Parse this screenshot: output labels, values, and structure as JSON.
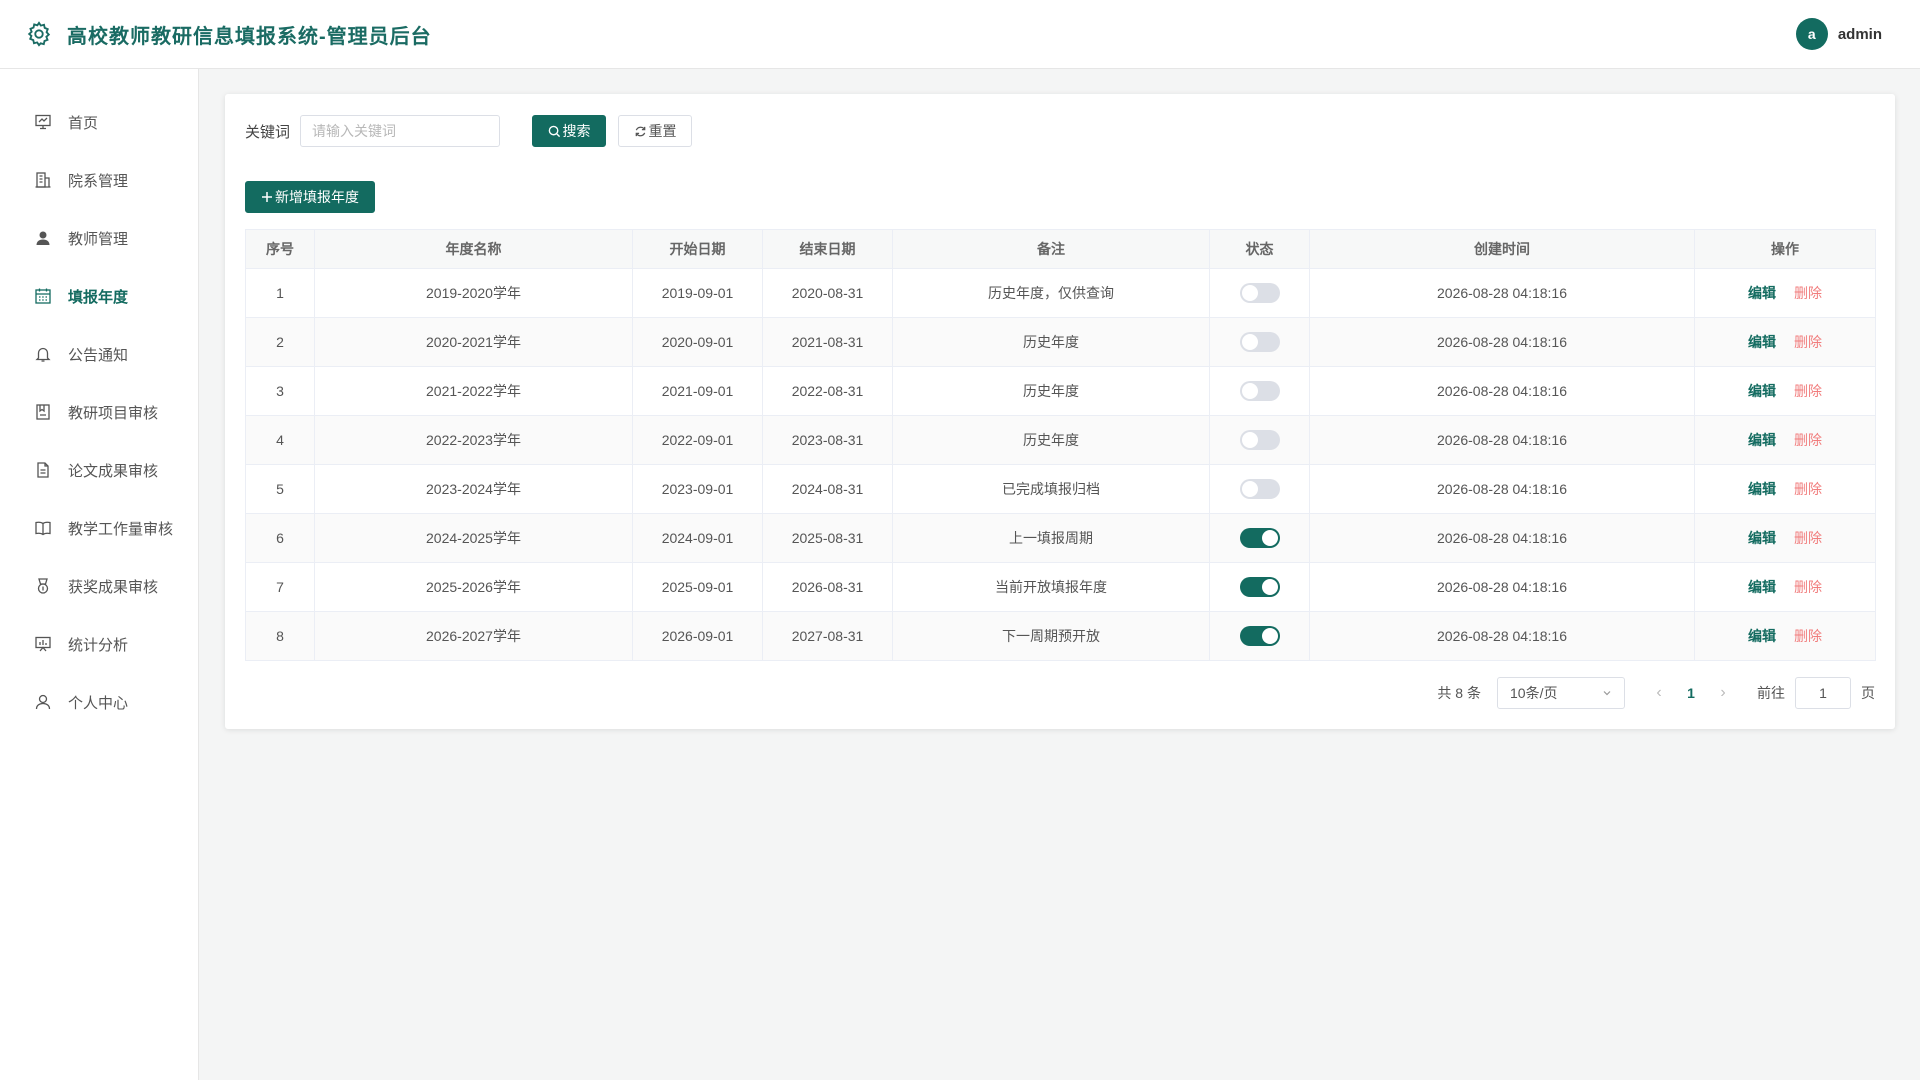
{
  "header": {
    "title": "高校教师教研信息填报系统-管理员后台",
    "avatar_letter": "a",
    "username": "admin"
  },
  "sidebar": {
    "items": [
      {
        "label": "首页",
        "icon": "dashboard-icon"
      },
      {
        "label": "院系管理",
        "icon": "building-icon"
      },
      {
        "label": "教师管理",
        "icon": "user-filled-icon"
      },
      {
        "label": "填报年度",
        "icon": "calendar-icon",
        "active": true
      },
      {
        "label": "公告通知",
        "icon": "bell-icon"
      },
      {
        "label": "教研项目审核",
        "icon": "notebook-icon"
      },
      {
        "label": "论文成果审核",
        "icon": "document-icon"
      },
      {
        "label": "教学工作量审核",
        "icon": "book-icon"
      },
      {
        "label": "获奖成果审核",
        "icon": "medal-icon"
      },
      {
        "label": "统计分析",
        "icon": "chart-board-icon"
      },
      {
        "label": "个人中心",
        "icon": "user-icon"
      }
    ]
  },
  "search": {
    "label": "关键词",
    "placeholder": "请输入关键词",
    "value": "",
    "search_label": "搜索",
    "reset_label": "重置"
  },
  "toolbar": {
    "add_label": "新增填报年度"
  },
  "table": {
    "columns": [
      "序号",
      "年度名称",
      "开始日期",
      "结束日期",
      "备注",
      "状态",
      "创建时间",
      "操作"
    ],
    "edit_label": "编辑",
    "delete_label": "删除",
    "rows": [
      {
        "index": "1",
        "name": "2019-2020学年",
        "start": "2019-09-01",
        "end": "2020-08-31",
        "remark": "历史年度，仅供查询",
        "enabled": false,
        "created": "2026-08-28 04:18:16"
      },
      {
        "index": "2",
        "name": "2020-2021学年",
        "start": "2020-09-01",
        "end": "2021-08-31",
        "remark": "历史年度",
        "enabled": false,
        "created": "2026-08-28 04:18:16"
      },
      {
        "index": "3",
        "name": "2021-2022学年",
        "start": "2021-09-01",
        "end": "2022-08-31",
        "remark": "历史年度",
        "enabled": false,
        "created": "2026-08-28 04:18:16"
      },
      {
        "index": "4",
        "name": "2022-2023学年",
        "start": "2022-09-01",
        "end": "2023-08-31",
        "remark": "历史年度",
        "enabled": false,
        "created": "2026-08-28 04:18:16"
      },
      {
        "index": "5",
        "name": "2023-2024学年",
        "start": "2023-09-01",
        "end": "2024-08-31",
        "remark": "已完成填报归档",
        "enabled": false,
        "created": "2026-08-28 04:18:16"
      },
      {
        "index": "6",
        "name": "2024-2025学年",
        "start": "2024-09-01",
        "end": "2025-08-31",
        "remark": "上一填报周期",
        "enabled": true,
        "created": "2026-08-28 04:18:16"
      },
      {
        "index": "7",
        "name": "2025-2026学年",
        "start": "2025-09-01",
        "end": "2026-08-31",
        "remark": "当前开放填报年度",
        "enabled": true,
        "created": "2026-08-28 04:18:16"
      },
      {
        "index": "8",
        "name": "2026-2027学年",
        "start": "2026-09-01",
        "end": "2027-08-31",
        "remark": "下一周期预开放",
        "enabled": true,
        "created": "2026-08-28 04:18:16"
      }
    ]
  },
  "pagination": {
    "total_text": "共 8 条",
    "page_size": "10条/页",
    "current_page": "1",
    "goto_label": "前往",
    "goto_value": "1",
    "goto_suffix": "页"
  },
  "colors": {
    "primary": "#136b60",
    "danger": "#f17c7c"
  }
}
